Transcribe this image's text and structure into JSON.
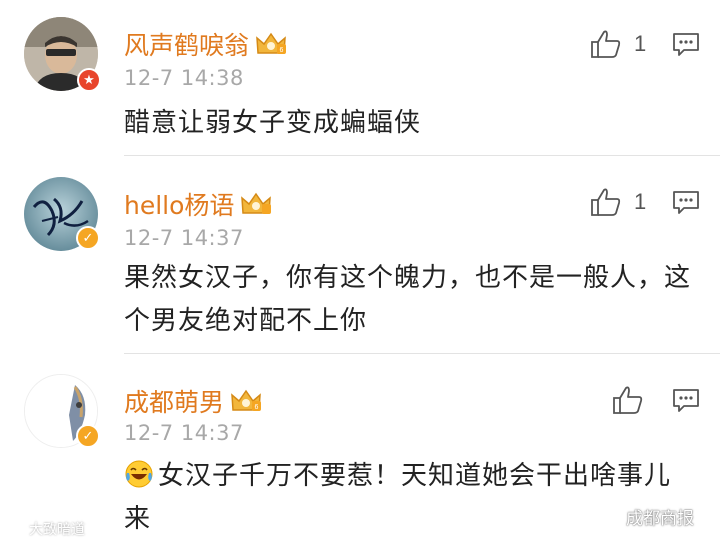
{
  "comments": [
    {
      "username": "风声鹤唳翁",
      "time": "12-7 14:38",
      "text": "醋意让弱女子变成蝙蝠侠",
      "likes": "1"
    },
    {
      "username": "hello杨语",
      "time": "12-7 14:37",
      "text": "果然女汉子，你有这个魄力，也不是一般人，这个男友绝对配不上你",
      "likes": "1"
    },
    {
      "username": "成都萌男",
      "time": "12-7 14:37",
      "text": "女汉子千万不要惹！天知道她会干出啥事儿来",
      "likes": ""
    }
  ],
  "watermarks": {
    "left": "大致暗道",
    "right": "成都商报"
  },
  "colors": {
    "username": "#e07a1f",
    "timestamp": "#a8a8a8",
    "text": "#222222",
    "divider": "#e3e3e3"
  }
}
